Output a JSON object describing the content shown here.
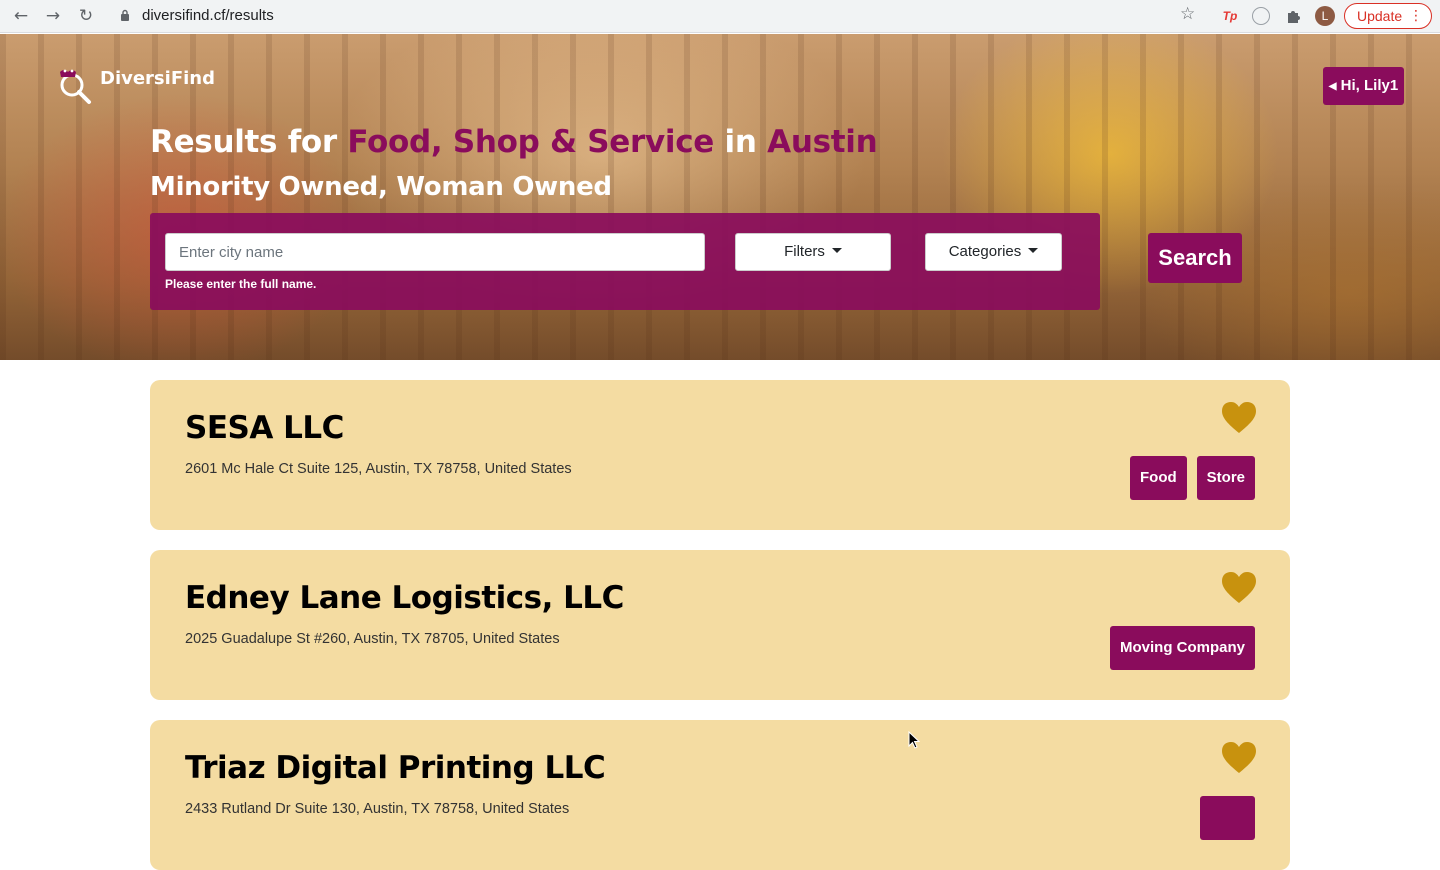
{
  "browser": {
    "url": "diversifind.cf/results",
    "update_label": "Update",
    "avatar_letter": "L",
    "ext_tp_label": "Tp"
  },
  "header": {
    "logo_text": "DiversiFind",
    "user_label": "Hi, Lily1"
  },
  "hero": {
    "title_prefix": "Results for ",
    "title_categories": "Food, Shop & Service",
    "title_in": " in ",
    "title_city": "Austin",
    "subtitle": "Minority Owned, Woman Owned"
  },
  "search": {
    "placeholder": "Enter city name",
    "hint": "Please enter the full name.",
    "filters_label": "Filters",
    "categories_label": "Categories",
    "search_label": "Search"
  },
  "results": [
    {
      "name": "SESA LLC",
      "address": "2601 Mc Hale Ct Suite 125, Austin, TX 78758, United States",
      "tags": [
        "Food",
        "Store"
      ]
    },
    {
      "name": "Edney Lane Logistics, LLC",
      "address": "2025 Guadalupe St #260, Austin, TX 78705, United States",
      "tags": [
        "Moving Company"
      ]
    },
    {
      "name": "Triaz Digital Printing LLC",
      "address": "2433 Rutland Dr Suite 130, Austin, TX 78758, United States",
      "tags": [
        ""
      ]
    }
  ],
  "colors": {
    "brand": "#8a0c5c",
    "card_bg": "#f4dca2",
    "heart": "#c8920e"
  }
}
